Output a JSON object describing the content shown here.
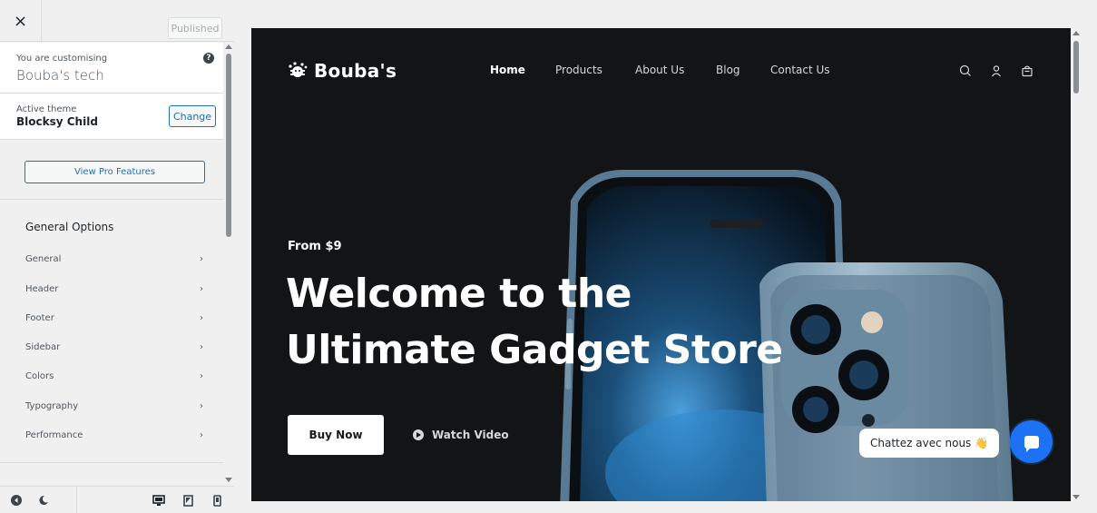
{
  "sidebar": {
    "close_label": "×",
    "published_label": "Published",
    "info_small": "You are customising",
    "site_name": "Bouba's tech",
    "help_label": "?",
    "theme_small": "Active theme",
    "theme_name": "Blocksy Child",
    "change_label": "Change",
    "pro_label": "View Pro Features",
    "options_title": "General Options",
    "options": [
      {
        "label": "General"
      },
      {
        "label": "Header"
      },
      {
        "label": "Footer"
      },
      {
        "label": "Sidebar"
      },
      {
        "label": "Colors"
      },
      {
        "label": "Typography"
      },
      {
        "label": "Performance"
      }
    ],
    "chevron": "›"
  },
  "preview": {
    "logo_text": "Bouba's",
    "nav": [
      "Home",
      "Products",
      "About Us",
      "Blog",
      "Contact Us"
    ],
    "from_text": "From $9",
    "headline_line1": "Welcome to the",
    "headline_line2": "Ultimate Gadget Store",
    "buy_label": "Buy Now",
    "watch_label": "Watch Video",
    "chat_text": "Chattez avec nous",
    "chat_emoji": "👋"
  },
  "colors": {
    "accent": "#2271b1",
    "hero_bg": "#131416",
    "chat_blue": "#1d72f3"
  }
}
